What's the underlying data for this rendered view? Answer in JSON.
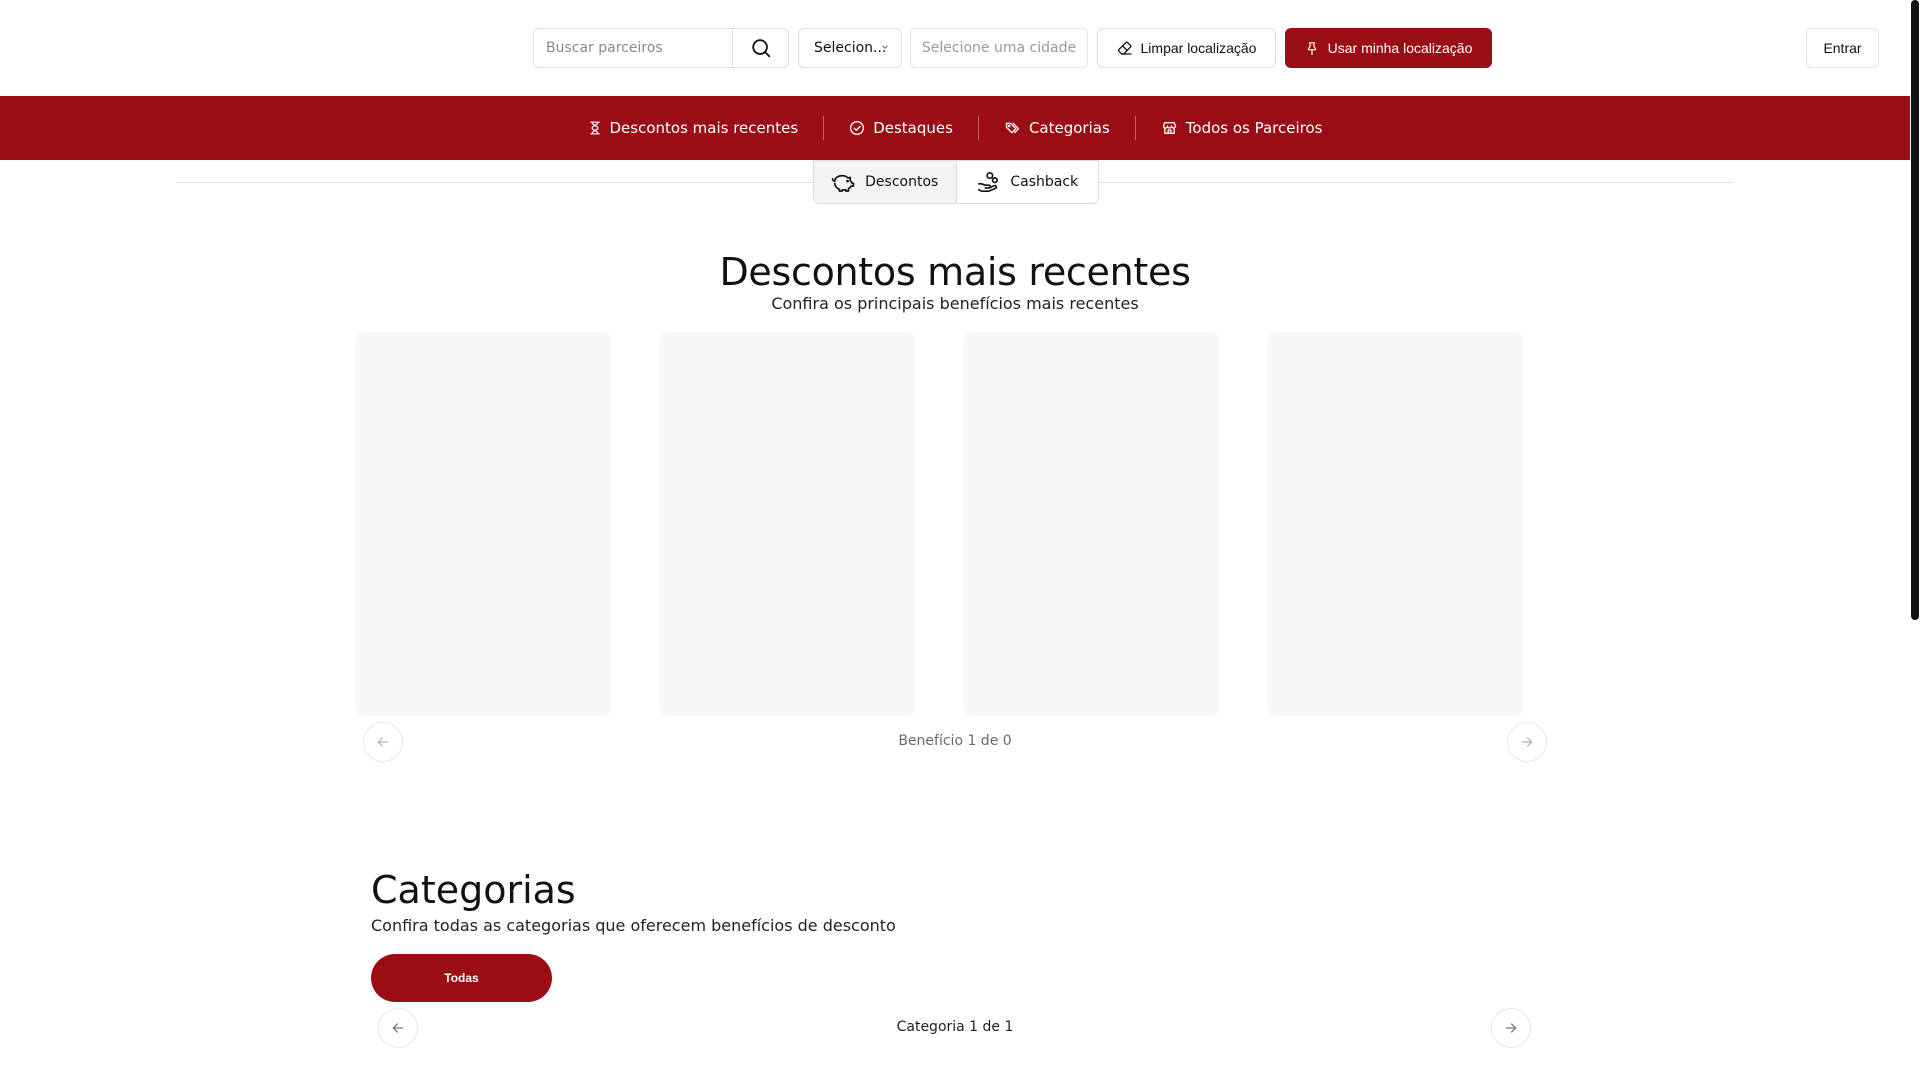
{
  "header": {
    "search": {
      "placeholder": "Buscar parceiros",
      "value": ""
    },
    "state_select": {
      "label": "Selecion..."
    },
    "city_select": {
      "label": "Selecione uma cidade"
    },
    "clear_location_label": "Limpar localização",
    "use_location_label": "Usar minha localização",
    "login_label": "Entrar"
  },
  "nav": {
    "items": [
      {
        "label": "Descontos mais recentes",
        "icon": "hourglass-icon"
      },
      {
        "label": "Destaques",
        "icon": "check-circle-icon"
      },
      {
        "label": "Categorias",
        "icon": "tags-icon"
      },
      {
        "label": "Todos os Parceiros",
        "icon": "store-icon"
      }
    ]
  },
  "tabs": [
    {
      "label": "Descontos",
      "icon": "piggy-bank-icon",
      "active": true
    },
    {
      "label": "Cashback",
      "icon": "hand-coins-icon",
      "active": false
    }
  ],
  "recent": {
    "title": "Descontos mais recentes",
    "subtitle": "Confira os principais benefícios mais recentes",
    "pager": "Benefício 1 de 0"
  },
  "categories": {
    "title": "Categorias",
    "subtitle": "Confira todas as categorias que oferecem benefícios de desconto",
    "chips": [
      "Todas"
    ],
    "pager": "Categoria 1 de 1"
  },
  "colors": {
    "brand": "#9b0d15",
    "card": "#f7f7f7"
  }
}
